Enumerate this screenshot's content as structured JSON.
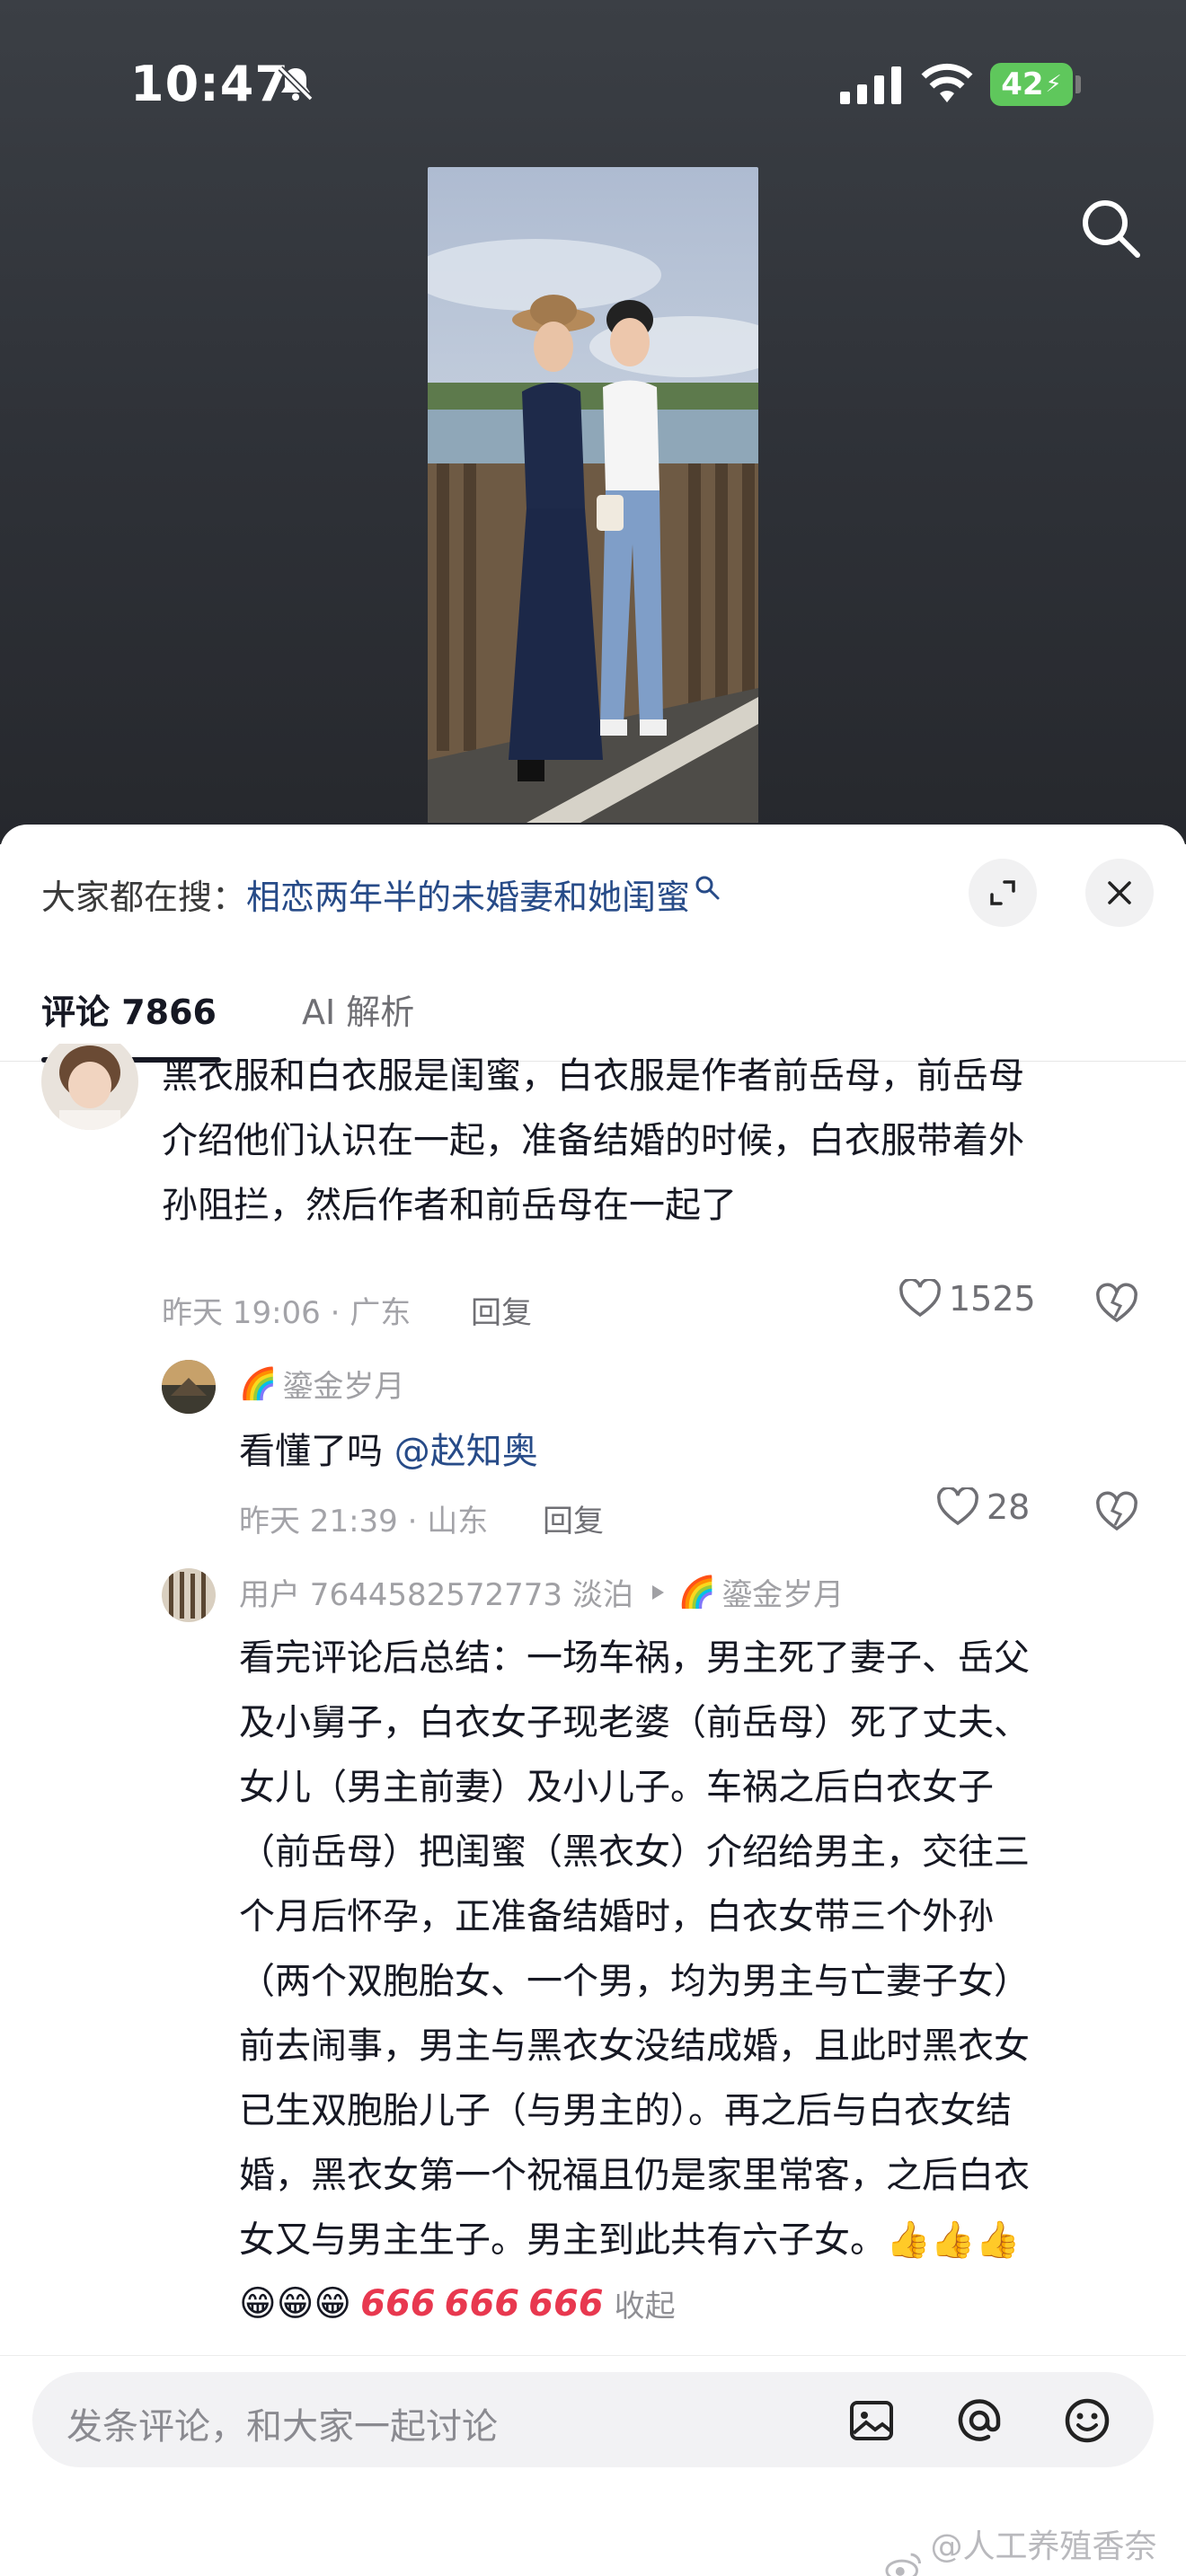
{
  "status_bar": {
    "time": "10:47",
    "battery": "42"
  },
  "icons": {
    "bell": "bell-off-icon",
    "signal": "signal-icon",
    "wifi": "wifi-icon",
    "search": "search-icon",
    "expand": "expand-icon",
    "close": "close-icon",
    "heart": "heart-icon",
    "dislike": "broken-heart-icon",
    "image": "image-icon",
    "at": "at-icon",
    "emoji": "smiley-icon",
    "weibo": "weibo-icon"
  },
  "search_bar": {
    "prefix": "大家都在搜：",
    "query": "相恋两年半的未婚妻和她闺蜜"
  },
  "tabs": {
    "comments": "评论 7866",
    "ai": "AI 解析"
  },
  "comments": [
    {
      "text_lines": [
        "黑衣服和白衣服是闺蜜，白衣服是作者前岳母，前岳母",
        "介绍他们认识在一起，准备结婚的时候，白衣服带着外",
        "孙阻拦，然后作者和前岳母在一起了"
      ],
      "time": "昨天 19:06 · 广东",
      "reply_label": "回复",
      "likes": "1525",
      "replies": [
        {
          "name_prefix": "🌈",
          "name": "鎏金岁月",
          "text": "看懂了吗",
          "mention": "@赵知奥",
          "time": "昨天 21:39 · 山东",
          "reply_label": "回复",
          "likes": "28"
        },
        {
          "name": "用户 7644582572773 淡泊",
          "reply_to_prefix": "🌈",
          "reply_to": "鎏金岁月",
          "text_lines": [
            "看完评论后总结：一场车祸，男主死了妻子、岳父",
            "及小舅子，白衣女子现老婆（前岳母）死了丈夫、",
            "女儿（男主前妻）及小儿子。车祸之后白衣女子",
            "（前岳母）把闺蜜（黑衣女）介绍给男主，交往三",
            "个月后怀孕，正准备结婚时，白衣女带三个外孙",
            "（两个双胞胎女、一个男，均为男主与亡妻子女）",
            "前去闹事，男主与黑衣女没结成婚，且此时黑衣女",
            "已生双胞胎儿子（与男主的）。再之后与白衣女结",
            "婚，黑衣女第一个祝福且仍是家里常客，之后白衣",
            "女又与男主生子。男主到此共有六子女。👍👍👍"
          ],
          "emojis": "😁😁😁",
          "tags": [
            "666",
            "666",
            "666"
          ],
          "collapse_label": "收起"
        }
      ]
    }
  ],
  "input": {
    "placeholder": "发条评论，和大家一起讨论"
  },
  "watermark": "@人工养殖香奈鹅",
  "colors": {
    "link": "#274b88",
    "battery": "#5fc75c",
    "tag": "#e8384f"
  }
}
